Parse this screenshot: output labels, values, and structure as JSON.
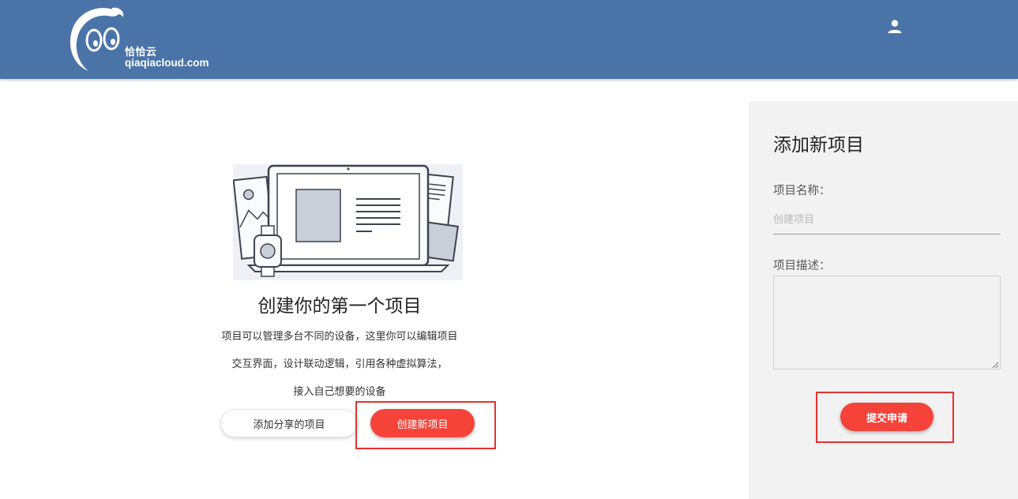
{
  "header": {
    "brand_cn": "恰恰云",
    "brand_domain": "qiaqiacloud.com",
    "background_color": "#4a74a8",
    "user_icon": "user-icon"
  },
  "hero": {
    "illustration_icon": "laptop-devices-illustration",
    "title": "创建你的第一个项目",
    "lines": [
      "项目可以管理多台不同的设备，这里你可以编辑项目",
      "交互界面，设计联动逻辑，引用各种虚拟算法，",
      "接入自己想要的设备"
    ],
    "share_button_label": "添加分享的项目",
    "create_button_label": "创建新项目"
  },
  "panel": {
    "title": "添加新项目",
    "name_label": "项目名称：",
    "name_placeholder": "创建项目",
    "name_value": "",
    "desc_label": "项目描述：",
    "desc_value": "",
    "submit_label": "提交申请"
  },
  "colors": {
    "accent": "#f5433a",
    "highlight": "#e8312d",
    "panel_bg": "#f2f2f2"
  }
}
